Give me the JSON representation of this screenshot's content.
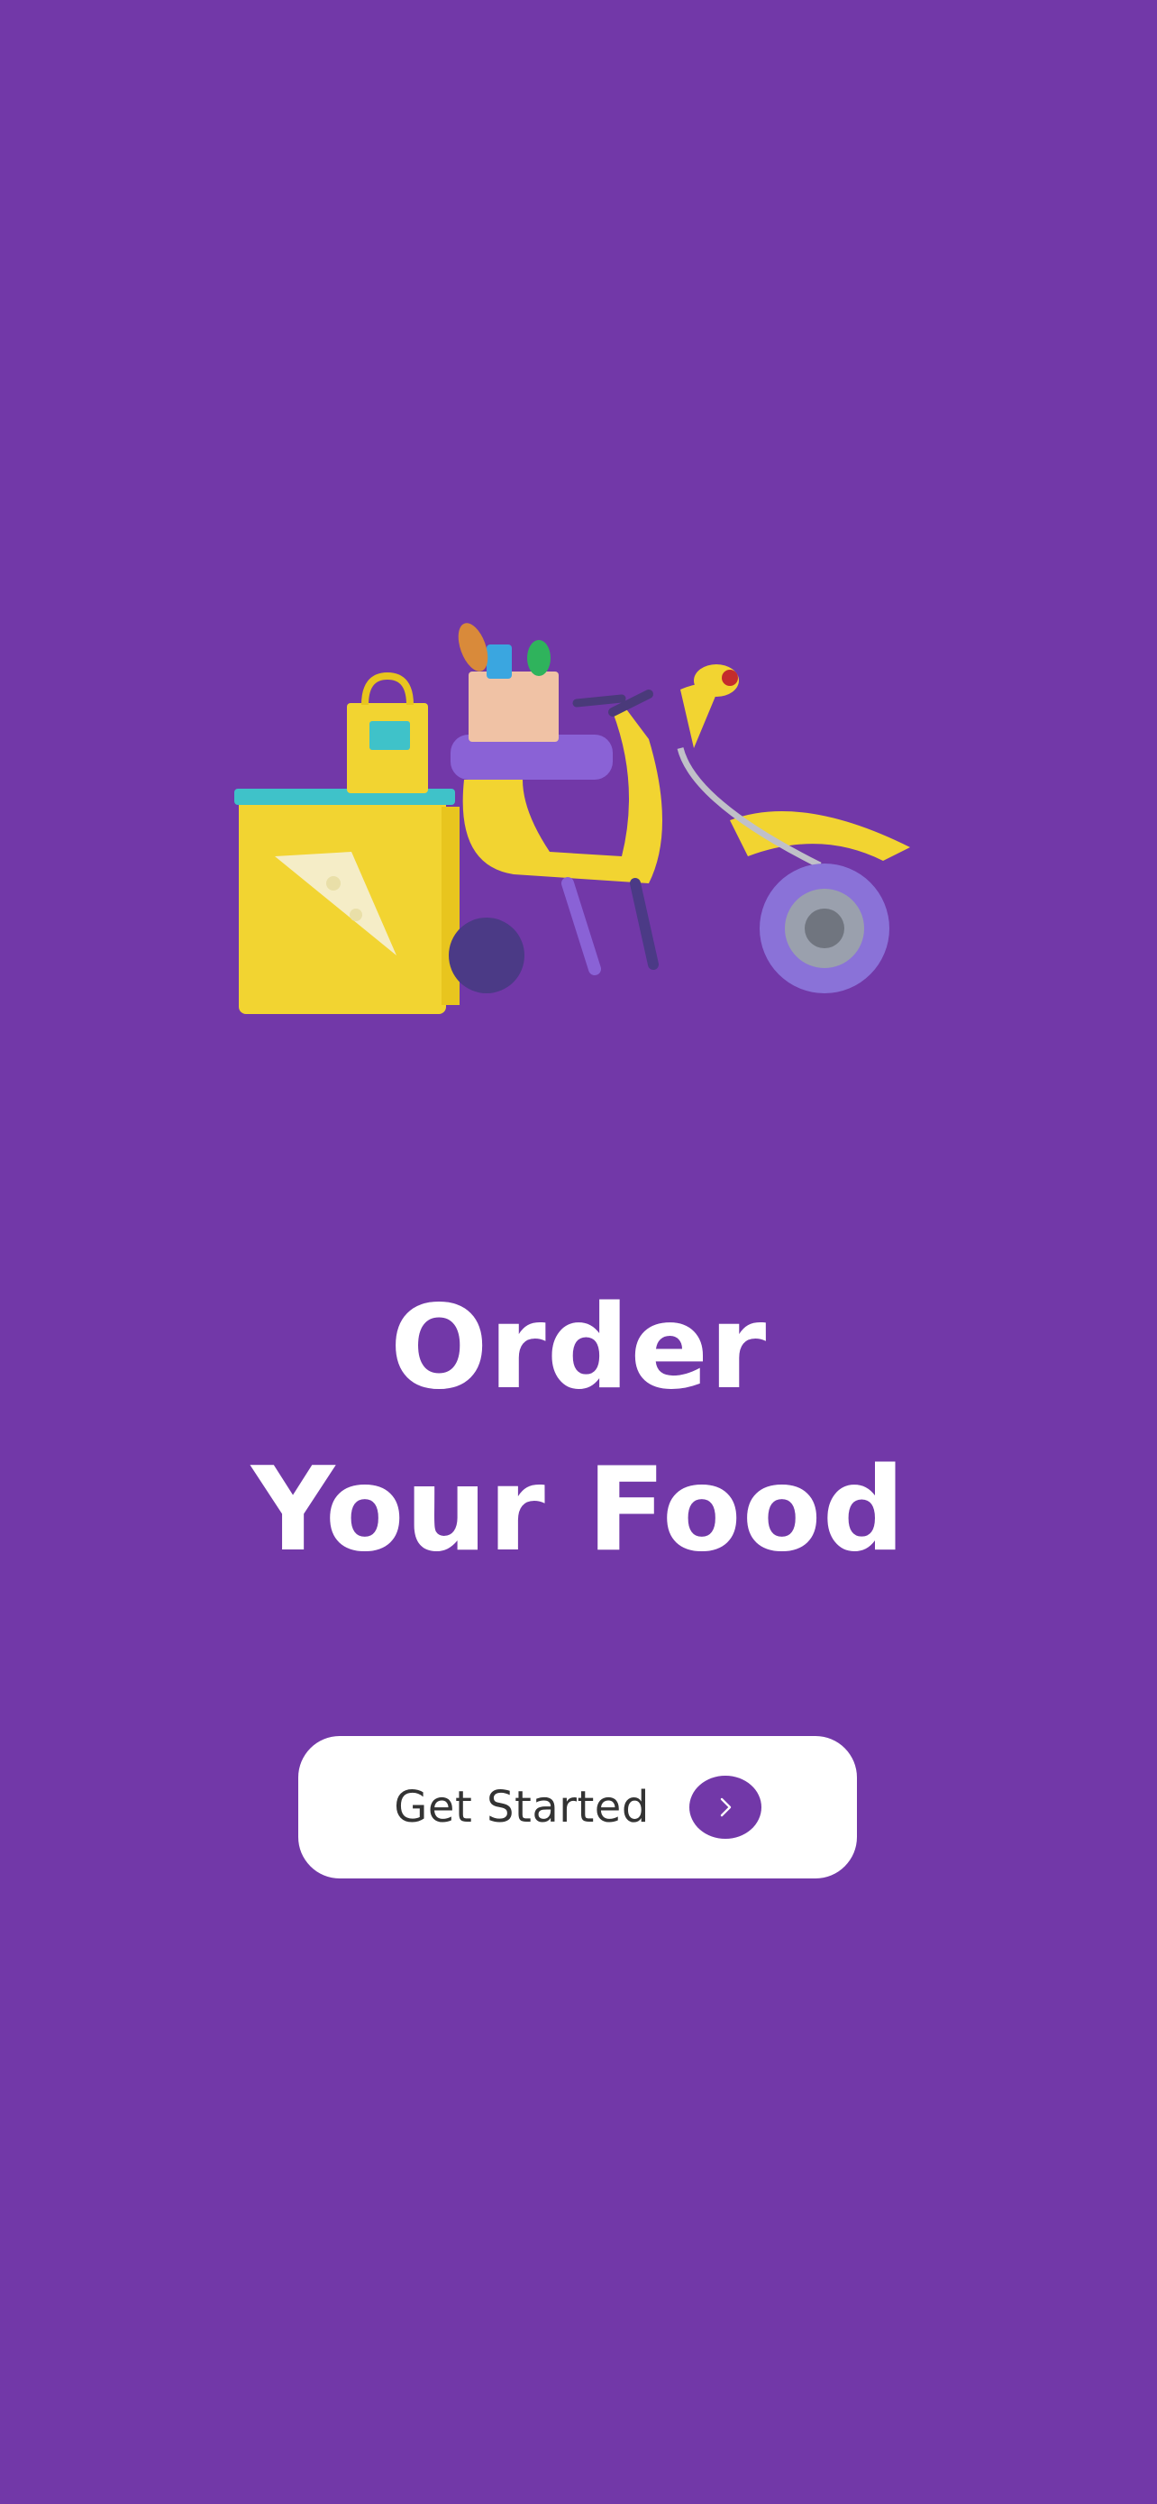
{
  "screen": {
    "background_color": "#7238A8"
  },
  "hero": {
    "illustration": "delivery-scooter-illustration"
  },
  "headline": {
    "line1": "Order",
    "line2": "Your Food"
  },
  "cta": {
    "label": "Get Started",
    "icon": "chevron-right-icon",
    "accent_color": "#7238A8"
  }
}
